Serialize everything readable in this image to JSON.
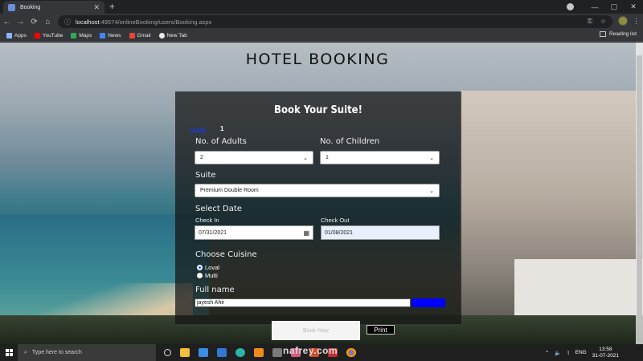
{
  "browser": {
    "tab_title": "Booking",
    "tab_close": "✕",
    "new_tab": "+",
    "url_host": "localhost",
    "url_rest": ":49574/onlineBooking/users/Booking.aspx",
    "window_controls": [
      "—",
      "▢",
      "✕"
    ],
    "nav": [
      "←",
      "→",
      "⟳",
      "⌂"
    ],
    "bookmarks": [
      {
        "label": "Apps",
        "icon": "apps-grid-icon",
        "color": "#8ab4f8"
      },
      {
        "label": "YouTube",
        "icon": "youtube-icon",
        "color": "#ff0000"
      },
      {
        "label": "Maps",
        "icon": "maps-icon",
        "color": "#34a853"
      },
      {
        "label": "News",
        "icon": "news-icon",
        "color": "#4285f4"
      },
      {
        "label": "Gmail",
        "icon": "gmail-icon",
        "color": "#ea4335"
      },
      {
        "label": "New Tab",
        "icon": "globe-icon",
        "color": "#e8eaed"
      }
    ],
    "reading_list": "Reading list"
  },
  "page": {
    "title": "HOTEL BOOKING",
    "panel_title": "Book Your Suite!",
    "logout_link": "Logout",
    "user_number": "1",
    "adults_label": "No. of Adults",
    "adults_value": "2",
    "children_label": "No. of Children",
    "children_value": "1",
    "suite_label": "Suite",
    "suite_value": "Premium Double Room",
    "date_label": "Select Date",
    "checkin_label": "Check In",
    "checkin_value": "07/31/2021",
    "checkout_label": "Check Out",
    "checkout_value": "01/08/2021",
    "cuisine_label": "Choose Cuisine",
    "cuisine_options": [
      {
        "label": "Loval",
        "checked": true
      },
      {
        "label": "Multi",
        "checked": false
      }
    ],
    "fullname_label": "Full name",
    "fullname_value": "jayesh Ahir",
    "next_button": "Book Now",
    "print_button": "Print"
  },
  "taskbar": {
    "search_placeholder": "Type here to search",
    "language": "ENG",
    "time": "13:58",
    "date": "31-07-2021"
  },
  "watermark": "nafrey.com"
}
